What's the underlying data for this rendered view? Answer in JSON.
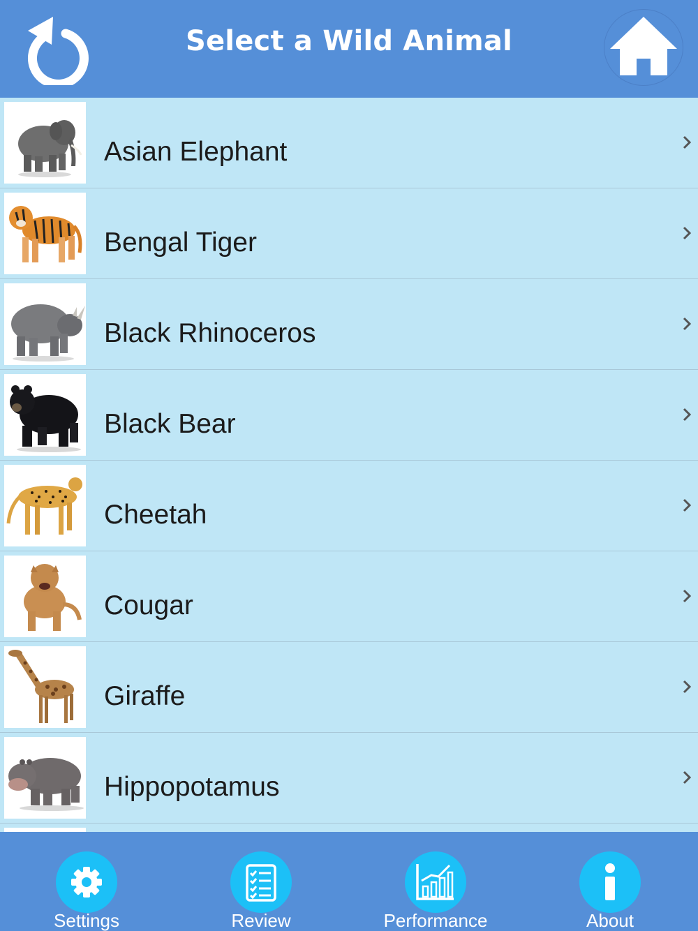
{
  "header": {
    "title": "Select a Wild Animal",
    "back_icon": "refresh-back-icon",
    "home_icon": "home-icon"
  },
  "list": {
    "items": [
      {
        "label": "Asian Elephant"
      },
      {
        "label": "Bengal Tiger"
      },
      {
        "label": "Black Rhinoceros"
      },
      {
        "label": "Black Bear"
      },
      {
        "label": "Cheetah"
      },
      {
        "label": "Cougar"
      },
      {
        "label": "Giraffe"
      },
      {
        "label": "Hippopotamus"
      }
    ]
  },
  "tabbar": {
    "tabs": [
      {
        "label": "Settings",
        "icon": "gear-icon"
      },
      {
        "label": "Review",
        "icon": "checklist-icon"
      },
      {
        "label": "Performance",
        "icon": "bar-chart-icon"
      },
      {
        "label": "About",
        "icon": "info-icon"
      }
    ]
  },
  "colors": {
    "header_bg": "#558fd8",
    "list_bg": "#bfe6f6",
    "tab_circle": "#1cc0f7",
    "text": "#1b1b1b"
  }
}
